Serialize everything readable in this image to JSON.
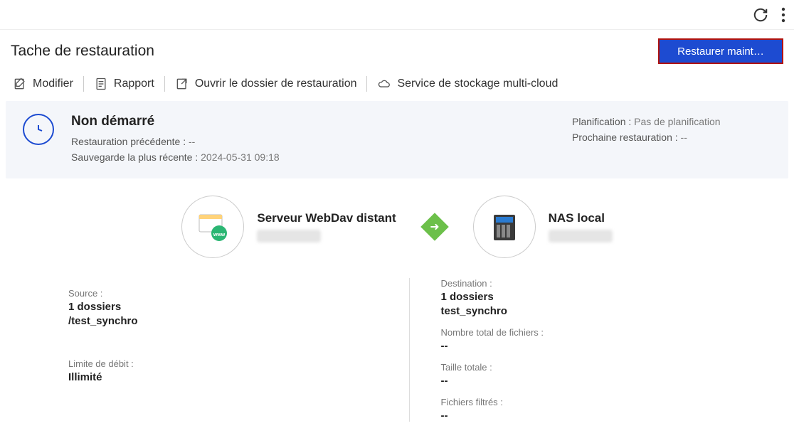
{
  "header": {
    "title": "Tache de restauration",
    "restore_button": "Restaurer maint…"
  },
  "actions": {
    "modify": "Modifier",
    "report": "Rapport",
    "open_folder": "Ouvrir le dossier de restauration",
    "multicloud": "Service de stockage multi-cloud"
  },
  "status": {
    "state": "Non démarré",
    "prev_restore_label": "Restauration précédente :",
    "prev_restore_value": "--",
    "last_backup_label": "Sauvegarde la plus récente :",
    "last_backup_value": "2024-05-31 09:18",
    "schedule_label": "Planification :",
    "schedule_value": "Pas de planification",
    "next_restore_label": "Prochaine restauration :",
    "next_restore_value": "--"
  },
  "flow": {
    "source_title": "Serveur WebDav distant",
    "dest_title": "NAS local"
  },
  "details": {
    "source_label": "Source :",
    "source_count": "1 dossiers",
    "source_path": "/test_synchro",
    "rate_label": "Limite de débit :",
    "rate_value": "Illimité",
    "dest_label": "Destination :",
    "dest_count": "1 dossiers",
    "dest_path": "test_synchro",
    "files_label": "Nombre total de fichiers :",
    "files_value": "--",
    "size_label": "Taille totale :",
    "size_value": "--",
    "filtered_label": "Fichiers filtrés :",
    "filtered_value": "--"
  }
}
